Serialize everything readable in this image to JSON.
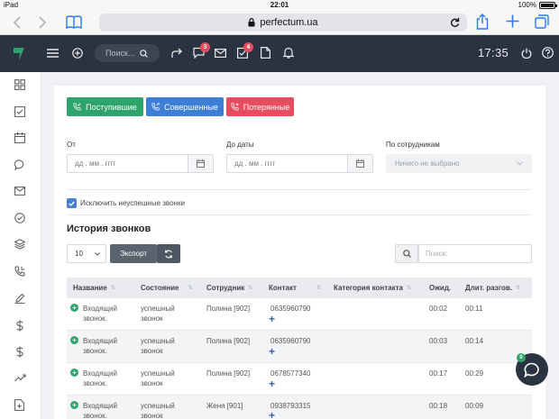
{
  "status_bar": {
    "device": "iPad",
    "time": "22:01",
    "battery": "100%",
    "battery_level": 1.0
  },
  "browser": {
    "url": "perfectum.ua"
  },
  "header": {
    "search_placeholder": "Поиск...",
    "badges": {
      "chat": "3",
      "tasks": "4"
    },
    "clock": "17:35",
    "brand_color": "#2ea36b"
  },
  "filters": {
    "incoming": "Поступившие",
    "outgoing": "Совершенные",
    "missed": "Потерянные",
    "from_label": "От",
    "from_placeholder": "дд . мм . гггг",
    "to_label": "До даты",
    "to_placeholder": "дд . мм . гггг",
    "staff_label": "По сотрудникам",
    "staff_value": "Ничего не выбрано",
    "exclude_label": "Исключить неуспешные звонки"
  },
  "history": {
    "title": "История звонков",
    "page_size": "10",
    "export_label": "Экспорт",
    "search_placeholder": "Поиск:"
  },
  "table": {
    "columns": [
      "Название",
      "Состояние",
      "Сотрудник",
      "Контакт",
      "Категория контакта",
      "Ожид.",
      "Длит. разгов."
    ],
    "rows": [
      {
        "name1": "Входящий",
        "name2": "звонок.",
        "state1": "успешный",
        "state2": "звонок",
        "staff": "Полина [902]",
        "contact": "0635960790",
        "category": "",
        "wait": "00:02",
        "dur": "00:11"
      },
      {
        "name1": "Входящий",
        "name2": "звонок.",
        "state1": "успешный",
        "state2": "звонок",
        "staff": "Полина [902]",
        "contact": "0635960790",
        "category": "",
        "wait": "00:03",
        "dur": "00:14"
      },
      {
        "name1": "Входящий",
        "name2": "звонок.",
        "state1": "успешный",
        "state2": "звонок",
        "staff": "Полина [902]",
        "contact": "0678577340",
        "category": "",
        "wait": "00:17",
        "dur": "00:29"
      },
      {
        "name1": "Входящий",
        "name2": "звонок.",
        "state1": "успешный",
        "state2": "звонок",
        "staff": "Женя [901]",
        "contact": "0938793315",
        "category": "",
        "wait": "00:18",
        "dur": "00:09"
      }
    ]
  },
  "chat": {
    "badge": "0"
  },
  "colors": {
    "green": "#2ea36b",
    "blue": "#3d7fd6",
    "red": "#e84c5f",
    "dark": "#2c3340",
    "export": "#5b636f"
  }
}
